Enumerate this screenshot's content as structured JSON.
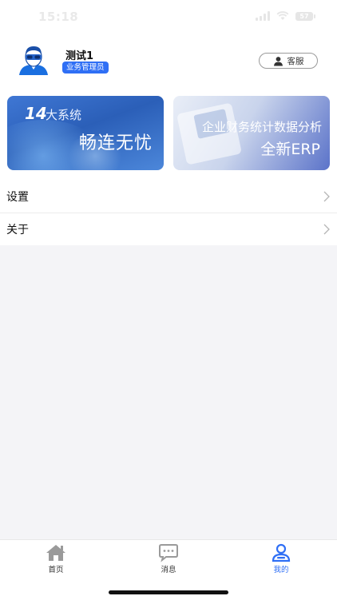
{
  "status_bar": {
    "time": "15:18",
    "battery": "57"
  },
  "profile": {
    "name": "测试1",
    "role": "业务管理员",
    "service_label": "客服"
  },
  "banners": {
    "left": {
      "number": "14",
      "sub": "大系统",
      "main": "畅连无忧"
    },
    "right": {
      "line1": "企业财务统计数据分析",
      "line2": "全新ERP"
    }
  },
  "menu": [
    {
      "label": "设置"
    },
    {
      "label": "关于"
    }
  ],
  "tabbar": [
    {
      "label": "首页",
      "icon": "home-icon",
      "active": false
    },
    {
      "label": "消息",
      "icon": "message-icon",
      "active": false
    },
    {
      "label": "我的",
      "icon": "profile-icon",
      "active": true
    }
  ],
  "colors": {
    "accent": "#2f6ff5",
    "inactive": "#8a8a8a",
    "background": "#f4f4f7"
  }
}
